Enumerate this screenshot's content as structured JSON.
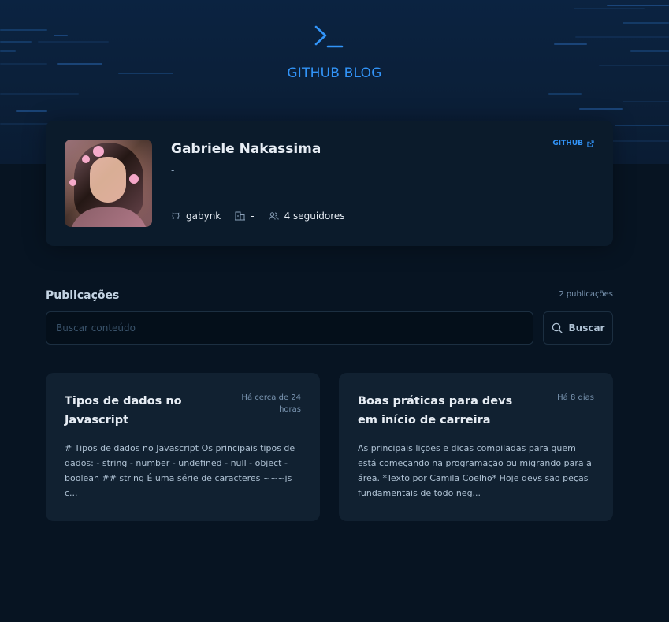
{
  "header": {
    "brand_title": "GITHUB BLOG",
    "icon": "terminal-prompt-icon"
  },
  "profile": {
    "name": "Gabriele Nakassima",
    "github_link": "GITHUB",
    "bio": "-",
    "username": "gabynk",
    "company": "-",
    "followers": "4 seguidores",
    "icons": {
      "github": "github-icon",
      "company": "building-icon",
      "followers": "users-icon",
      "external": "external-link-icon"
    }
  },
  "publications": {
    "title": "Publicações",
    "count": "2 publicações",
    "search_placeholder": "Buscar conteúdo",
    "search_button": "Buscar",
    "posts": [
      {
        "title": "Tipos de dados no Javascript",
        "date": "Há cerca de 24 horas",
        "excerpt": "# Tipos de dados no Javascript Os principais tipos de dados: - string - number - undefined - null - object - boolean ## string É uma série de caracteres ~~~js c..."
      },
      {
        "title": "Boas práticas para devs em início de carreira",
        "date": "Há 8 dias",
        "excerpt": "As principais lições e dicas compiladas para quem está começando na programação ou migrando para a área. *Texto por Camila Coelho* Hoje devs são peças fundamentais de todo neg..."
      }
    ]
  },
  "colors": {
    "brand_blue": "#3294f8",
    "background": "#071422",
    "card": "#112131",
    "profile_card": "#0b1b2b"
  }
}
